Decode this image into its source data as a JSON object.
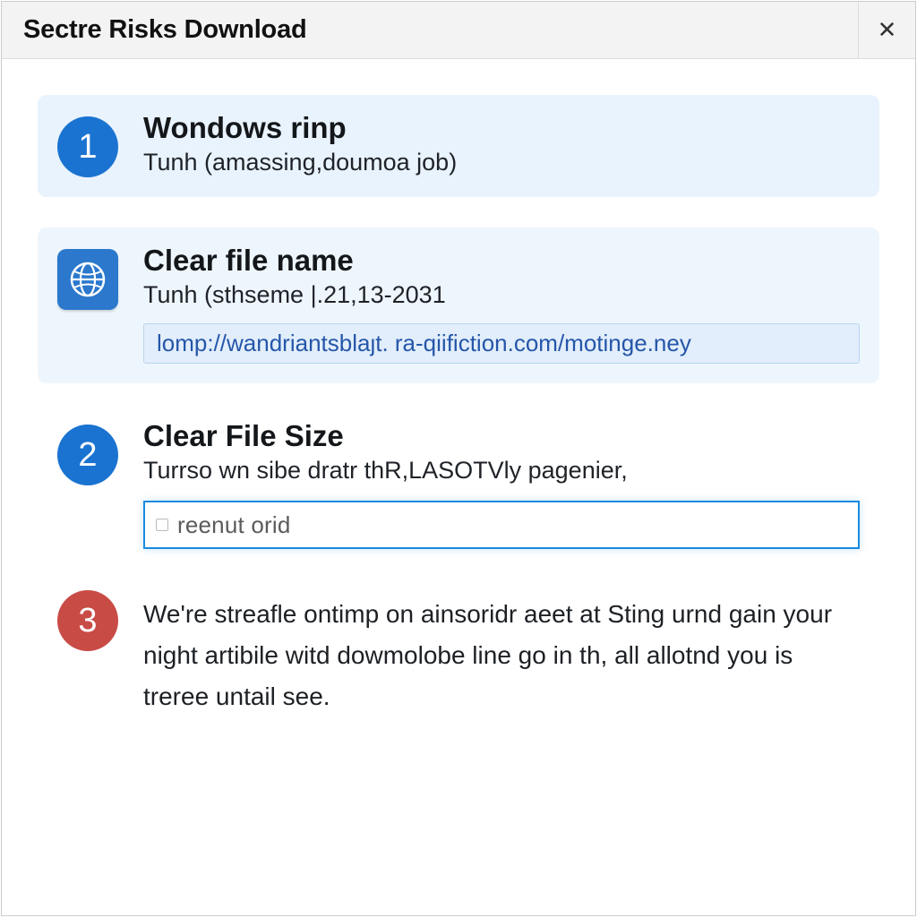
{
  "dialog": {
    "title": "Sectre Risks Download",
    "close_glyph": "✕"
  },
  "steps": {
    "one": {
      "number": "1",
      "title": "Wondows rinp",
      "subtitle": "Tunh (amassing,doumoa job)"
    },
    "globe": {
      "title": "Clear file name",
      "subtitle": "Tunh (sthseme |.21,13-2031",
      "link": "lomp://wandriantsblaȷt. ra‑qiifiction.com/motinge.ney"
    },
    "two": {
      "number": "2",
      "title": "Clear File Size",
      "subtitle": "Turrso wn sibe dratr thR,LASOTVly pagenier,",
      "input_value": "reenut orid"
    },
    "three": {
      "number": "3",
      "paragraph": "We're streafle ontimp on ainsoridr aeet at Sting urnd gain your night artibile witd dowmolobe line go in th, all allotnd you is treree untail see."
    }
  }
}
